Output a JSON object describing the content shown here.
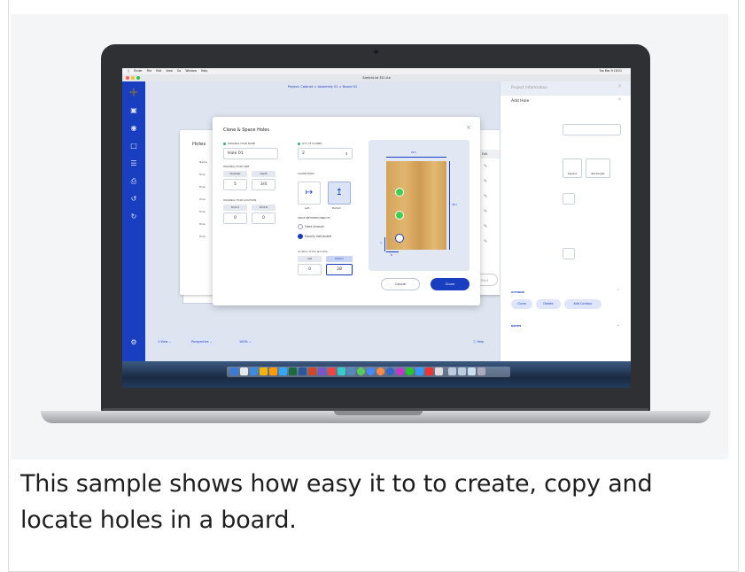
{
  "caption": "This sample shows how easy it to to create, copy and locate holes in a board.",
  "mac_menu": {
    "items": [
      "Finder",
      "File",
      "Edit",
      "View",
      "Go",
      "Window",
      "Help"
    ],
    "right": "Tue Mar 9 18:01"
  },
  "app": {
    "title": "SketchList 3D Lite",
    "breadcrumb": "Project: Cabinet  >  Assembly 01  >  Board 01"
  },
  "holes_panel": {
    "title": "Holes",
    "rows": [
      "Name",
      "Hole",
      "Hole",
      "Hole",
      "Hole",
      "Hole",
      "Hole"
    ]
  },
  "list_panel": {
    "headers": [
      "Edit",
      "Clone",
      "Delete"
    ],
    "print_label": "Print",
    "ok_label": "OK"
  },
  "properties": {
    "header": "Project Information",
    "sub": "Add Hole",
    "shapes": [
      "Square",
      "Rectangle"
    ],
    "actions_label": "ACTIONS",
    "clone_label": "Clone",
    "delete_label": "Delete",
    "add_contour_label": "Add Contour",
    "notes_label": "NOTES"
  },
  "bottom_bar": {
    "view": "1 View",
    "perspective": "Perspective",
    "zoom": "100%",
    "help": "Help"
  },
  "dialog": {
    "title": "Clone & Space Holes",
    "original_name_label": "ORIGINAL HOLE NAME",
    "original_name_value": "Hole 01",
    "size_label": "ORIGINAL HOLE SIZE",
    "diameter_label": "Diameter",
    "depth_label": "Depth",
    "diameter_value": "5",
    "depth_value": "3/4",
    "location_label": "ORIGINAL HOLE LOCATION",
    "point_a_label": "Point A",
    "point_b_label": "Point B",
    "point_a_value": "0",
    "point_b_value": "0",
    "clones_label": "QTY OF CLONES",
    "clones_value": "2",
    "clone_from_label": "CLONE FROM",
    "left_label": "Left",
    "bottom_label": "Bottom",
    "spacing_label": "SPACE BETWEEN OBJECTS",
    "fixed_label": "Fixed Amount",
    "equal_label": "Equally distributed",
    "last_hole_label": "Location of the last hole",
    "last_left_label": "Left",
    "last_bottom_label": "Bottom",
    "last_left_value": "0",
    "last_bottom_value": "28",
    "width_dim": "20.5",
    "height_dim": "38.5",
    "axis_a": "A",
    "axis_b": "B",
    "cancel_label": "Cancel",
    "clone_label": "Clone"
  },
  "colors": {
    "accent": "#1a3ec0",
    "hole_green": "#3fcf50",
    "wood": "#d9a962"
  }
}
